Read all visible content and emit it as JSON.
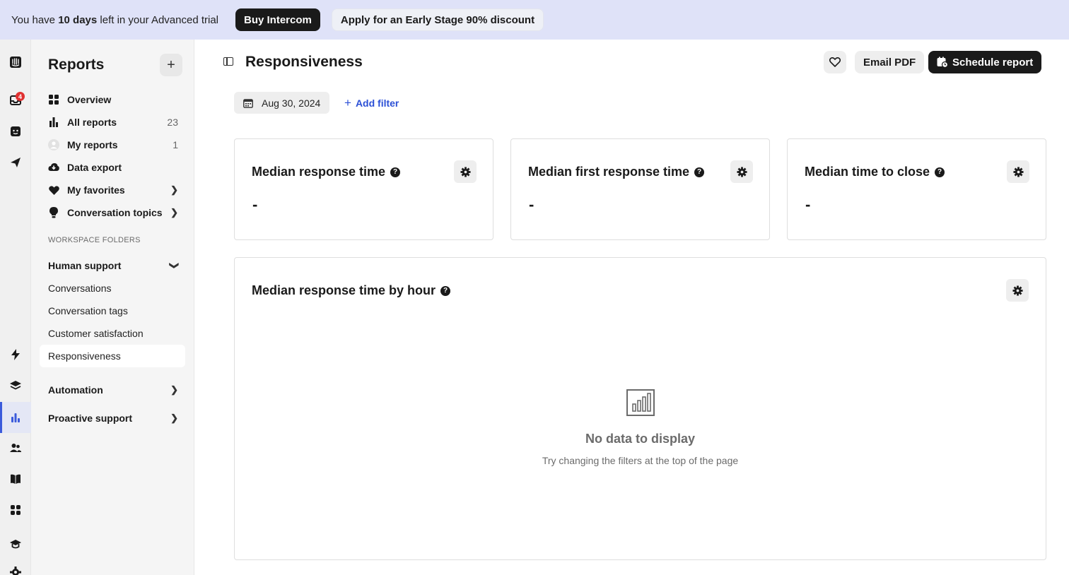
{
  "banner": {
    "text_prefix": "You have ",
    "text_bold": "10 days",
    "text_suffix": " left in your Advanced trial",
    "buy_label": "Buy Intercom",
    "discount_label": "Apply for an Early Stage 90% discount"
  },
  "rail": {
    "inbox_badge": "4",
    "items": [
      "intercom-logo-icon",
      "inbox-icon",
      "fin-bot-icon",
      "outbound-icon",
      "lightning-icon",
      "layers-icon",
      "reports-icon",
      "contacts-icon",
      "knowledge-icon",
      "apps-icon",
      "academy-icon",
      "settings-icon"
    ],
    "active": "reports-icon",
    "active_color": "#3b5bdb"
  },
  "sidebar": {
    "title": "Reports",
    "nav": [
      {
        "label": "Overview",
        "icon": "grid-icon"
      },
      {
        "label": "All reports",
        "icon": "bar-chart-icon",
        "count": "23"
      },
      {
        "label": "My reports",
        "icon": "avatar",
        "count": "1"
      },
      {
        "label": "Data export",
        "icon": "cloud-download-icon"
      },
      {
        "label": "My favorites",
        "icon": "heart-icon"
      },
      {
        "label": "Conversation topics",
        "icon": "lightbulb-icon"
      }
    ],
    "section_label": "WORKSPACE FOLDERS",
    "folders": [
      {
        "label": "Human support",
        "expanded": true,
        "children": [
          "Conversations",
          "Conversation tags",
          "Customer satisfaction",
          "Responsiveness"
        ]
      },
      {
        "label": "Automation",
        "expanded": false
      },
      {
        "label": "Proactive support",
        "expanded": false
      }
    ],
    "active_child": "Responsiveness"
  },
  "main": {
    "title": "Responsiveness",
    "email_pdf_label": "Email PDF",
    "schedule_label": "Schedule report",
    "date_filter": "Aug 30, 2024",
    "add_filter_label": "Add filter",
    "accent": "#2c50d6",
    "metrics": [
      {
        "title": "Median response time",
        "value": "-"
      },
      {
        "title": "Median first response time",
        "value": "-"
      },
      {
        "title": "Median time to close",
        "value": "-"
      }
    ],
    "chart_card": {
      "title": "Median response time by hour",
      "empty_title": "No data to display",
      "empty_subtitle": "Try changing the filters at the top of the page"
    }
  }
}
